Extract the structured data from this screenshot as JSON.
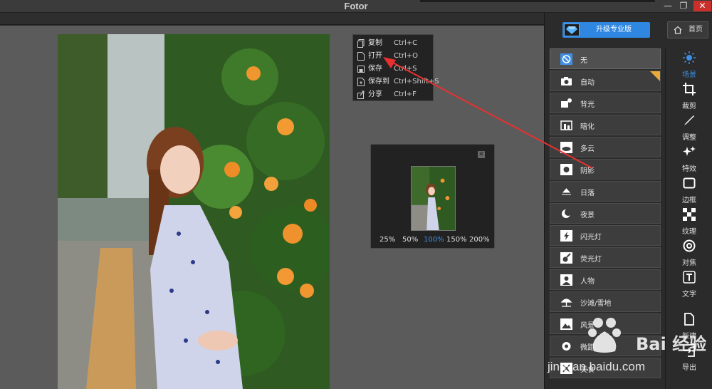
{
  "window": {
    "title": "Fotor",
    "controls": [
      "—",
      "❐",
      "✕"
    ]
  },
  "context_menu": {
    "items": [
      {
        "label": "复制",
        "shortcut": "Ctrl+C",
        "icon": "copy-icon"
      },
      {
        "label": "打开",
        "shortcut": "Ctrl+O",
        "icon": "open-file-icon"
      },
      {
        "label": "保存",
        "shortcut": "Ctrl+S",
        "icon": "save-icon"
      },
      {
        "label": "保存到",
        "shortcut": "Ctrl+Shift+S",
        "icon": "save-as-icon"
      },
      {
        "label": "分享",
        "shortcut": "Ctrl+F",
        "icon": "share-icon"
      }
    ]
  },
  "preview": {
    "zoom_levels": [
      "25%",
      "50%",
      "100%",
      "150%",
      "200%"
    ],
    "active_zoom": "100%",
    "close": "✕"
  },
  "header": {
    "upgrade_label": "升级专业版",
    "home_label": "首页"
  },
  "effects": [
    {
      "label": "无",
      "icon": "none-icon",
      "selected": true
    },
    {
      "label": "自动",
      "icon": "camera-auto-icon"
    },
    {
      "label": "背光",
      "icon": "backlight-icon"
    },
    {
      "label": "暗化",
      "icon": "darken-icon"
    },
    {
      "label": "多云",
      "icon": "cloudy-icon"
    },
    {
      "label": "阴影",
      "icon": "shade-icon"
    },
    {
      "label": "日落",
      "icon": "sunset-icon"
    },
    {
      "label": "夜景",
      "icon": "night-icon"
    },
    {
      "label": "闪光灯",
      "icon": "flash-icon"
    },
    {
      "label": "荧光灯",
      "icon": "fluorescent-icon"
    },
    {
      "label": "人物",
      "icon": "portrait-icon"
    },
    {
      "label": "沙滩/雪地",
      "icon": "beach-icon"
    },
    {
      "label": "风景",
      "icon": "landscape-icon"
    },
    {
      "label": "微距",
      "icon": "macro-icon"
    },
    {
      "label": "美食",
      "icon": "food-icon"
    }
  ],
  "tools": [
    {
      "label": "场景",
      "icon": "scene-icon",
      "active": true
    },
    {
      "label": "裁剪",
      "icon": "crop-icon"
    },
    {
      "label": "调整",
      "icon": "adjust-icon"
    },
    {
      "label": "特效",
      "icon": "effects-icon"
    },
    {
      "label": "边框",
      "icon": "frame-icon"
    },
    {
      "label": "纹理",
      "icon": "texture-icon"
    },
    {
      "label": "对焦",
      "icon": "focus-icon"
    },
    {
      "label": "文字",
      "icon": "text-icon"
    },
    {
      "label": "新建",
      "icon": "new-icon"
    },
    {
      "label": "导出",
      "icon": "export-icon"
    }
  ],
  "watermark": {
    "brand": "Bai 经验",
    "url": "jingyan.baidu.com"
  },
  "colors": {
    "accent": "#2f87e1",
    "active_text": "#3f8fe6",
    "arrow": "#e8312f",
    "pro_badge": "#e8a83a"
  }
}
